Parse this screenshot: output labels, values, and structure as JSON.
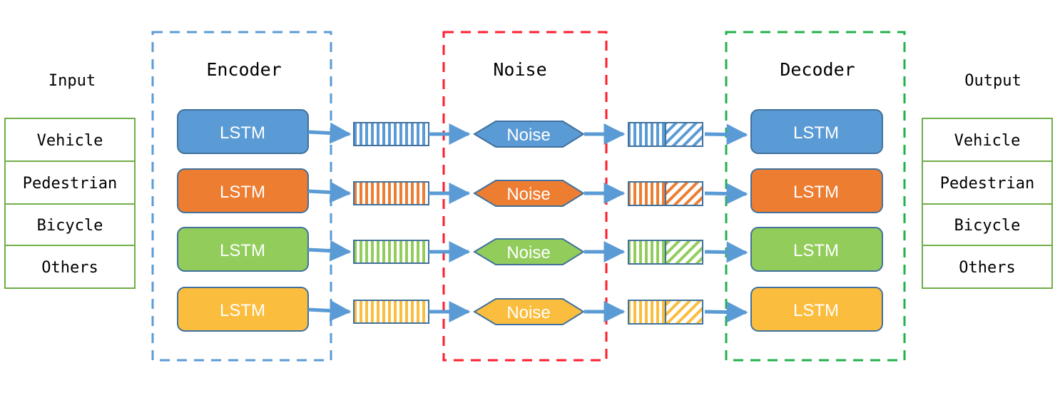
{
  "input": {
    "title": "Input",
    "items": [
      "Vehicle",
      "Pedestrian",
      "Bicycle",
      "Others"
    ],
    "border_color": "#70AD47"
  },
  "output": {
    "title": "Output",
    "items": [
      "Vehicle",
      "Pedestrian",
      "Bicycle",
      "Others"
    ],
    "border_color": "#70AD47"
  },
  "encoder": {
    "title": "Encoder",
    "border_color": "#5B9BD5",
    "cell_label": "LSTM"
  },
  "noise_block": {
    "title": "Noise",
    "border_color": "#FF1E2D",
    "node_label": "Noise"
  },
  "decoder": {
    "title": "Decoder",
    "border_color": "#22B04B",
    "cell_label": "LSTM"
  },
  "rows": [
    {
      "name": "vehicle",
      "color": "#5B9BD5"
    },
    {
      "name": "pedestrian",
      "color": "#ED7D31"
    },
    {
      "name": "bicycle",
      "color": "#92CD5C"
    },
    {
      "name": "others",
      "color": "#FBBD3D"
    }
  ],
  "arrow_color": "#5B9BD5",
  "outline_color": "#41719C"
}
